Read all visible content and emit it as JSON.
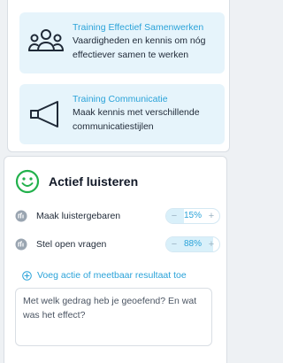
{
  "trainings": [
    {
      "title": "Training Effectief Samenwerken",
      "description": "Vaardigheden en kennis om nóg effectiever samen te werken",
      "icon": "people-group-icon"
    },
    {
      "title": "Training Communicatie",
      "description": "Maak kennis met verschillende communicatiestijlen",
      "icon": "megaphone-icon"
    }
  ],
  "skill": {
    "title": "Actief luisteren",
    "icon": "smiley-icon",
    "accent_color": "#22b14c",
    "goals": [
      {
        "label": "Maak luistergebaren",
        "value": "15%",
        "progress": 0.15,
        "icon": "goal-status-icon"
      },
      {
        "label": "Stel open vragen",
        "value": "88%",
        "progress": 0.88,
        "icon": "goal-status-icon"
      }
    ],
    "add_action_label": "Voeg actie of meetbaar resultaat toe",
    "reflection_placeholder": "Met welk gedrag heb je geoefend? En wat was het effect?"
  },
  "colors": {
    "link": "#2ba3d9",
    "card_background": "#e6f4fb"
  }
}
